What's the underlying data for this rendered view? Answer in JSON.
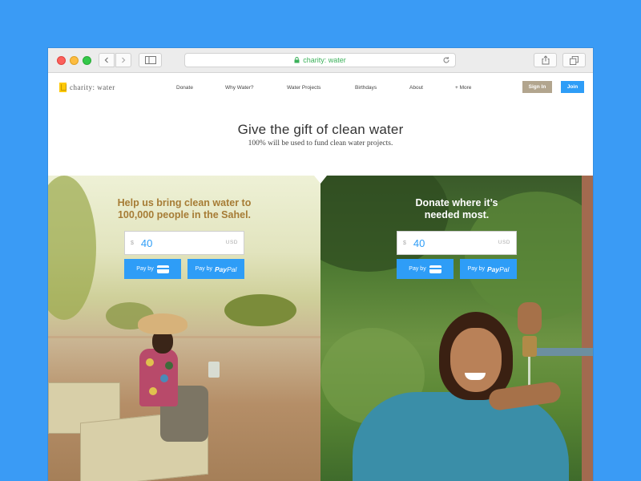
{
  "browser": {
    "url": "charity: water"
  },
  "site": {
    "logo_text": "charity: water",
    "nav": [
      {
        "label": "Donate"
      },
      {
        "label": "Why Water?"
      },
      {
        "label": "Water Projects"
      },
      {
        "label": "Birthdays"
      },
      {
        "label": "About"
      },
      {
        "label": "+ More"
      }
    ],
    "signin_label": "Sign In",
    "join_label": "Join"
  },
  "hero": {
    "title": "Give the gift of clean water",
    "subtitle": "100% will be used to fund clean water projects."
  },
  "campaigns": [
    {
      "title_line1": "Help us bring clean water to",
      "title_line2": "100,000 people in the Sahel.",
      "currency_symbol": "$",
      "amount": "40",
      "currency_code": "USD",
      "pay_card_label": "Pay by",
      "pay_paypal_prefix": "Pay by",
      "paypal_pay": "Pay",
      "paypal_pal": "Pal"
    },
    {
      "title_line1": "Donate where it’s",
      "title_line2": "needed most.",
      "currency_symbol": "$",
      "amount": "40",
      "currency_code": "USD",
      "pay_card_label": "Pay by",
      "pay_paypal_prefix": "Pay by",
      "paypal_pay": "Pay",
      "paypal_pal": "Pal"
    }
  ],
  "colors": {
    "background": "#3a9bf5",
    "accent": "#2e9df7",
    "signin": "#b2a58e",
    "left_title": "#a67c35",
    "url_green": "#3cb15b"
  },
  "icons": [
    "back-icon",
    "forward-icon",
    "sidebar-icon",
    "lock-icon",
    "reload-icon",
    "share-icon",
    "tabs-icon",
    "credit-card-icon"
  ]
}
